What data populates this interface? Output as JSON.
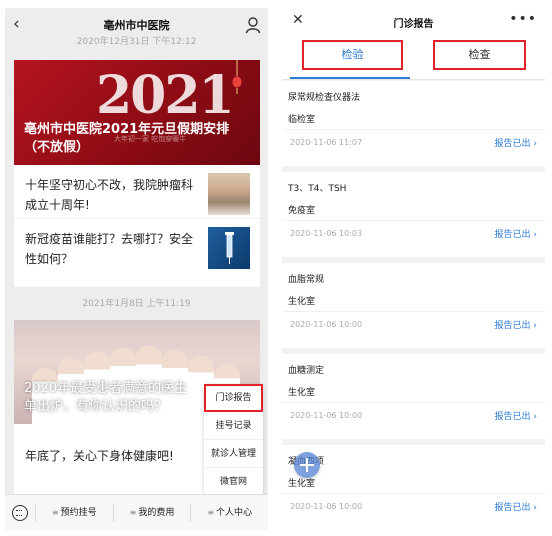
{
  "left": {
    "header": {
      "title": "亳州市中医院",
      "back_icon": "chevron-left-icon",
      "user_icon": "user-icon"
    },
    "feed": {
      "date1": "2020年12月31日 下午12:12",
      "banner1_headline": "亳州市中医院2021年元旦假期安排（不放假）",
      "banner1_watermark": "大年初一家 吃饱穿暖牛",
      "news": [
        {
          "text": "十年坚守初心不改，我院肿瘤科成立十周年!"
        },
        {
          "text": "新冠疫苗谁能打？去哪打？安全性如何？"
        }
      ],
      "date2": "2021年1月8日 上午11:19",
      "banner2_headline": "2020年最受患者满意的医生单出炉，有你认识的吗？",
      "news2": "年底了，关心下身体健康吧!"
    },
    "popup_menu": [
      "门诊报告",
      "挂号记录",
      "就诊人管理",
      "微官网"
    ],
    "tabbar": {
      "keyboard_icon": "keyboard-icon",
      "tabs": [
        "预约挂号",
        "我的费用",
        "个人中心"
      ]
    }
  },
  "right": {
    "header": {
      "title": "门诊报告",
      "close_icon": "close-icon",
      "more_icon": "more-icon"
    },
    "tabs": [
      "检验",
      "检查"
    ],
    "records": [
      {
        "name": "尿常规检查仪器法",
        "dept": "临检室",
        "date": "2020-11-06  11:07",
        "status": "报告已出 ›"
      },
      {
        "name": "T3、T4、TSH",
        "dept": "免疫室",
        "date": "2020-11-06  10:03",
        "status": "报告已出 ›"
      },
      {
        "name": "血脂常规",
        "dept": "生化室",
        "date": "2020-11-06  10:00",
        "status": "报告已出 ›"
      },
      {
        "name": "血糖测定",
        "dept": "生化室",
        "date": "2020-11-06  10:00",
        "status": "报告已出 ›"
      },
      {
        "name": "凝血四项",
        "dept": "生化室",
        "date": "2020-11-06  10:00",
        "status": "报告已出 ›"
      }
    ],
    "float_icon": "plus-icon"
  },
  "colors": {
    "accent": "#2a7ad6",
    "highlight": "#e0222a",
    "banner_red": "#b5141f"
  }
}
